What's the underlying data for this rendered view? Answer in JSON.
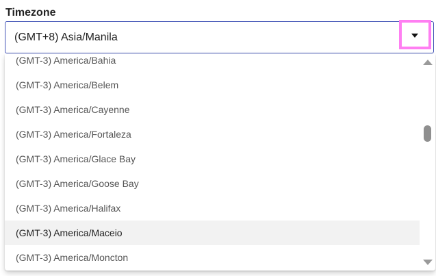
{
  "field": {
    "label": "Timezone",
    "selected_value": "(GMT+8) Asia/Manila",
    "toggle_highlight_color": "#ff7ff2",
    "border_color": "#3f51b5"
  },
  "dropdown": {
    "options": [
      {
        "label": "(GMT-3) America/Bahia"
      },
      {
        "label": "(GMT-3) America/Belem"
      },
      {
        "label": "(GMT-3) America/Cayenne"
      },
      {
        "label": "(GMT-3) America/Fortaleza"
      },
      {
        "label": "(GMT-3) America/Glace Bay"
      },
      {
        "label": "(GMT-3) America/Goose Bay"
      },
      {
        "label": "(GMT-3) America/Halifax"
      },
      {
        "label": "(GMT-3) America/Maceio",
        "hovered": true
      },
      {
        "label": "(GMT-3) America/Moncton"
      }
    ],
    "scroll_position": 0.33
  },
  "icons": {
    "toggle": "chevron-down-icon",
    "scroll_up": "arrow-up-icon",
    "scroll_down": "arrow-down-icon"
  }
}
